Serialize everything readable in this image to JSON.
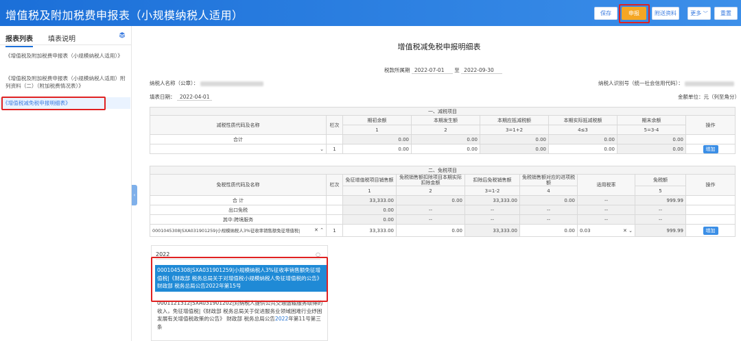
{
  "header": {
    "title": "增值税及附加税费申报表（小规模纳税人适用）",
    "buttons": {
      "save": "保存",
      "declare": "申报",
      "attachments": "附送资料",
      "more": "更多",
      "reset": "重置"
    }
  },
  "sidebar": {
    "tabs": [
      "报表列表",
      "填表说明"
    ],
    "items": [
      "《增值税及附加税费申报表（小规模纳税人适用）》",
      "《增值税及附加税费申报表（小规模纳税人适用）附列资料（二）（附加税费情况表）》",
      "《增值税减免税申报明细表》"
    ]
  },
  "form": {
    "title": "增值税减免税申报明细表",
    "period_label": "税款所属期",
    "period_start": "2022-07-01",
    "period_to": "至",
    "period_end": "2022-09-30",
    "taxpayer_name_label": "纳税人名称（公章）：",
    "taxpayer_id_label": "纳税人识别号（统一社会信用代码）：",
    "fill_date_label": "填表日期：",
    "fill_date": "2022-04-01",
    "unit_label": "金额单位：元（列至角分）"
  },
  "section1": {
    "title": "一、减税项目",
    "headers": {
      "name": "减税性质代码及名称",
      "row": "栏次",
      "c1": "期初余额",
      "c2": "本期发生额",
      "c3": "本期应抵减税额",
      "c4": "本期实际抵减税额",
      "c5": "期末余额",
      "op": "操作"
    },
    "colnums": [
      "1",
      "2",
      "3=1+2",
      "4≤3",
      "5=3-4"
    ],
    "total_label": "合计",
    "total": [
      "0.00",
      "0.00",
      "0.00",
      "0.00",
      "0.00"
    ],
    "row1_no": "1",
    "row1": [
      "0.00",
      "0.00",
      "0.00",
      "0.00",
      "0.00"
    ],
    "add": "增加",
    "select_arrow": "⌄"
  },
  "section2": {
    "title": "二、免税项目",
    "headers": {
      "name": "免税性质代码及名称",
      "row": "栏次",
      "c1": "免征增值税项目销售额",
      "c2": "免税销售额扣除项目本期实际扣除金额",
      "c3": "扣除后免税销售额",
      "c4": "免税销售额对应的进项税额",
      "rate": "适用税率",
      "c5": "免税额",
      "op": "操作"
    },
    "colnums": [
      "1",
      "2",
      "3=1-2",
      "4",
      "5"
    ],
    "rows": [
      {
        "label": "合  计",
        "v": [
          "33,333.00",
          "0.00",
          "33,333.00",
          "0.00",
          "--",
          "999.99"
        ]
      },
      {
        "label": "出口免税",
        "v": [
          "0.00",
          "--",
          "--",
          "--",
          "--",
          "--"
        ]
      },
      {
        "label": "其中:跨境服务",
        "v": [
          "0.00",
          "--",
          "--",
          "--",
          "--",
          "--"
        ]
      }
    ],
    "row1_code": "0001045308|SXA031901259|小规模纳税人3%征收率销售额免征增值税|",
    "row1_no": "1",
    "row1": [
      "33,333.00",
      "0.00",
      "33,333.00",
      "0.00"
    ],
    "row1_rate": "0.03",
    "row1_free": "999.99",
    "add": "增加"
  },
  "dropdown": {
    "search_value": "2022",
    "options": [
      {
        "text_pre": "0001045308|SXA031901259|小规模纳税人3%征收率销售额免征增值税|《财政部 税务总局关于对增值税小规模纳税人免征增值税的公告》 财政部 税务总局公告2022年第15号",
        "selected": true
      },
      {
        "text_pre": "0001121312|SXA031901202|对纳税人提供公共交通运输服务取得的收入，免征增值税|《财政部 税务总局关于促进服务业领域困难行业纾困发展有关增值税政策的公告》 财政部 税务总局公告",
        "hl": "2022",
        "text_post": "年第11号第三条",
        "selected": false
      }
    ]
  },
  "colors": {
    "header_blue": "#1b6fd8",
    "accent_orange": "#f5a623",
    "highlight_red": "#e02020",
    "select_blue": "#1f8ad6"
  }
}
